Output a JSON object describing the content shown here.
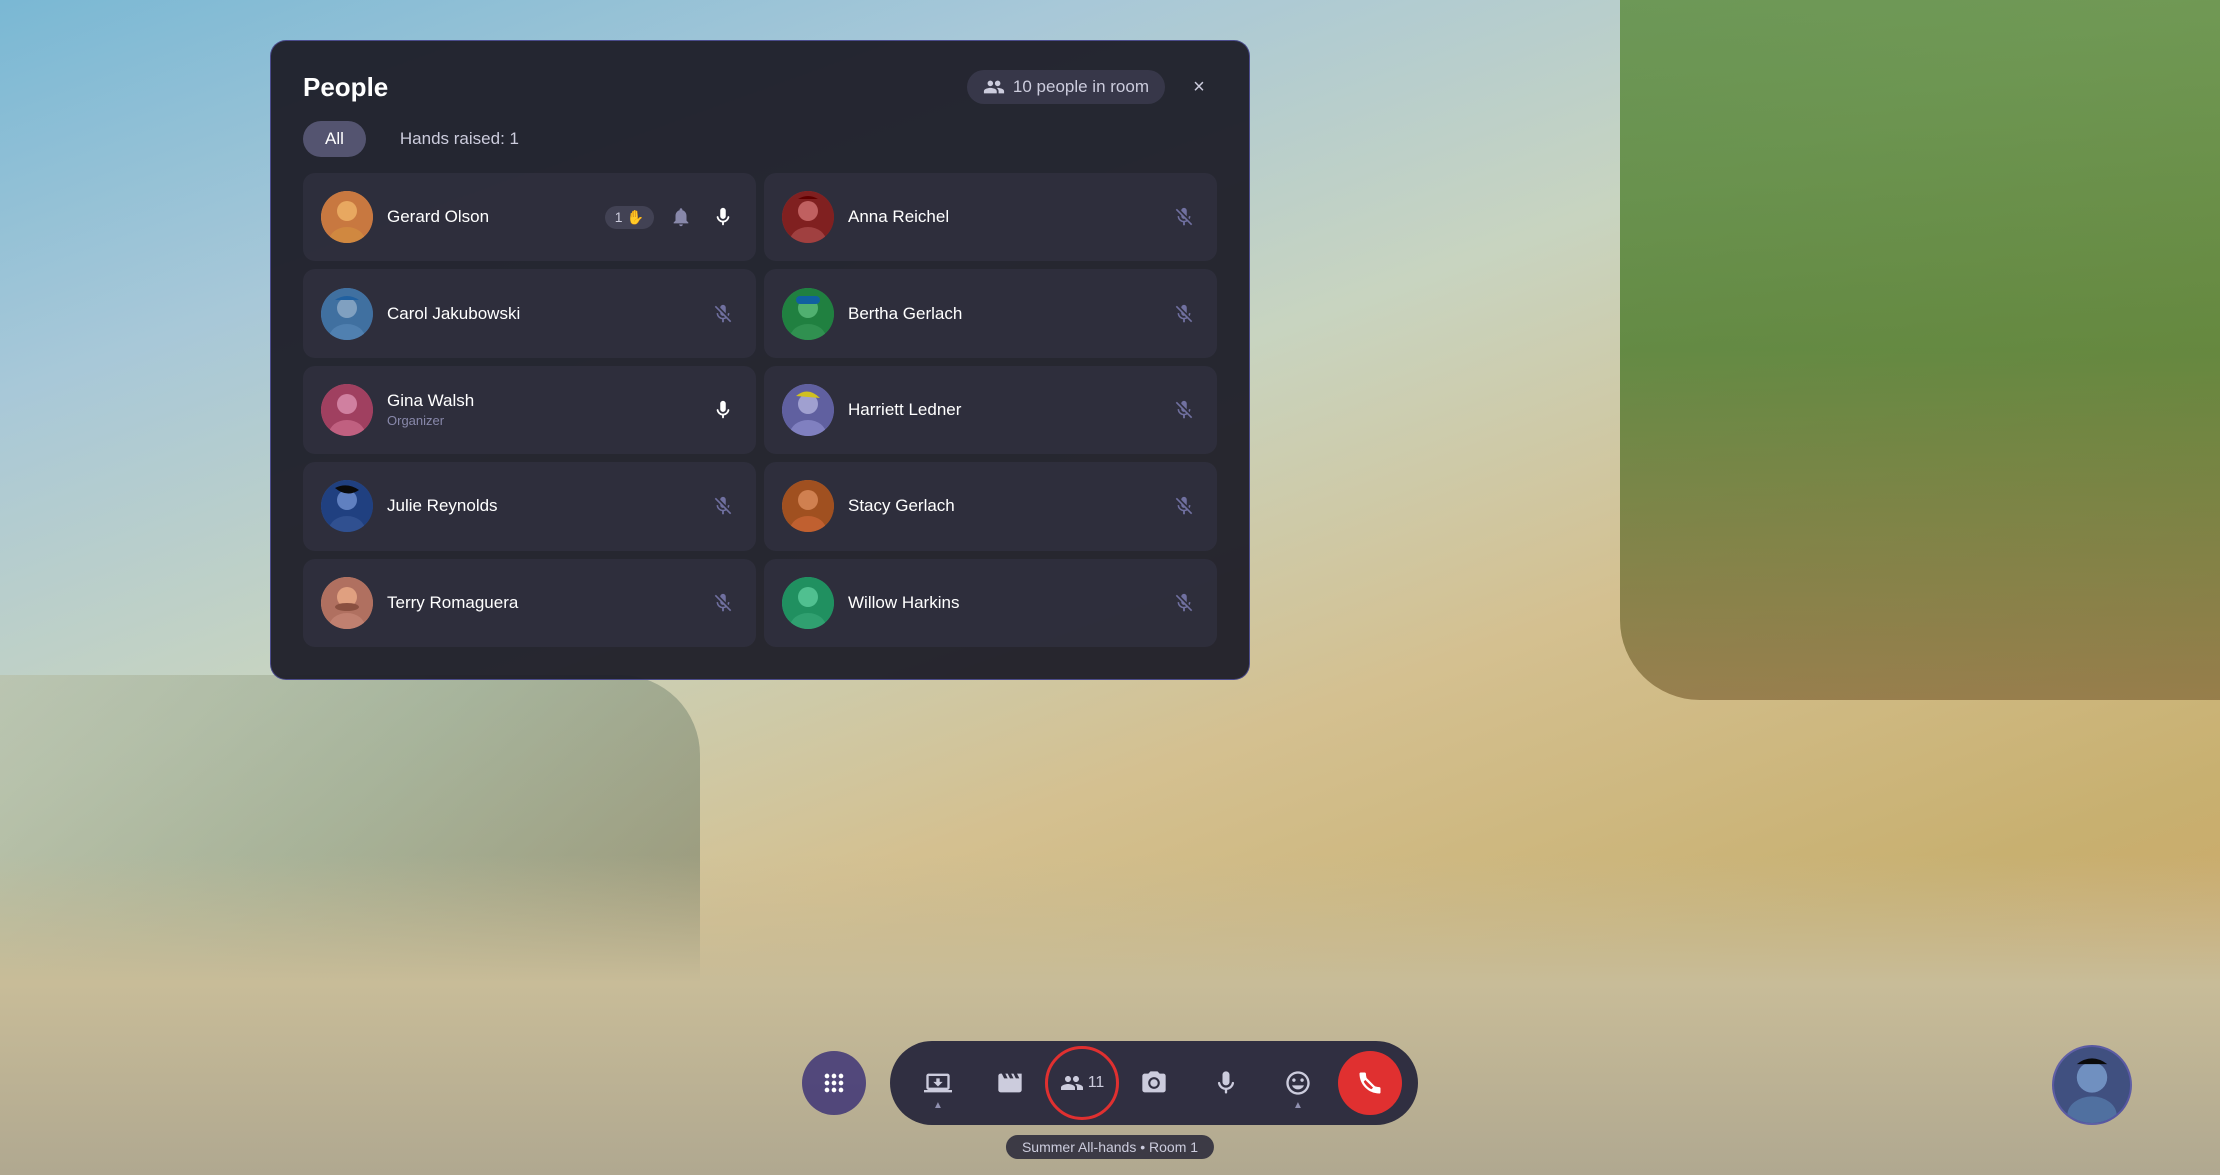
{
  "background": {
    "description": "Virtual meeting room with couch, tree, outdoor scene"
  },
  "panel": {
    "title": "People",
    "people_count": "10 people in room",
    "close_label": "×",
    "tabs": [
      {
        "id": "all",
        "label": "All",
        "active": true
      },
      {
        "id": "hands",
        "label": "Hands raised: 1",
        "active": false
      }
    ],
    "participants": [
      {
        "id": "gerard",
        "name": "Gerard Olson",
        "role": "",
        "hand_raised": true,
        "hand_count": "1",
        "muted": false,
        "has_bell": true,
        "avatar_class": "av-gerard",
        "avatar_emoji": "🧑"
      },
      {
        "id": "anna",
        "name": "Anna Reichel",
        "role": "",
        "hand_raised": false,
        "muted": true,
        "avatar_class": "av-anna",
        "avatar_emoji": "👩"
      },
      {
        "id": "carol",
        "name": "Carol Jakubowski",
        "role": "",
        "hand_raised": false,
        "muted": true,
        "avatar_class": "av-carol",
        "avatar_emoji": "👩"
      },
      {
        "id": "bertha",
        "name": "Bertha Gerlach",
        "role": "",
        "hand_raised": false,
        "muted": true,
        "avatar_class": "av-bertha",
        "avatar_emoji": "👩"
      },
      {
        "id": "gina",
        "name": "Gina Walsh",
        "role": "Organizer",
        "hand_raised": false,
        "muted": false,
        "avatar_class": "av-gina",
        "avatar_emoji": "👩"
      },
      {
        "id": "harriett",
        "name": "Harriett Ledner",
        "role": "",
        "hand_raised": false,
        "muted": true,
        "avatar_class": "av-harriett",
        "avatar_emoji": "👩"
      },
      {
        "id": "julie",
        "name": "Julie Reynolds",
        "role": "",
        "hand_raised": false,
        "muted": true,
        "avatar_class": "av-julie",
        "avatar_emoji": "👩"
      },
      {
        "id": "stacy",
        "name": "Stacy Gerlach",
        "role": "",
        "hand_raised": false,
        "muted": true,
        "avatar_class": "av-stacy",
        "avatar_emoji": "👩"
      },
      {
        "id": "terry",
        "name": "Terry Romaguera",
        "role": "",
        "hand_raised": false,
        "muted": true,
        "avatar_class": "av-terry",
        "avatar_emoji": "🧔"
      },
      {
        "id": "willow",
        "name": "Willow Harkins",
        "role": "",
        "hand_raised": false,
        "muted": true,
        "avatar_class": "av-willow",
        "avatar_emoji": "👩"
      }
    ]
  },
  "toolbar": {
    "dots_label": "⋮⋮⋮",
    "share_label": "share",
    "content_label": "content",
    "people_label": "people",
    "people_count": "11",
    "camera_label": "camera",
    "mic_label": "mic",
    "emoji_label": "emoji",
    "end_label": "end",
    "meeting_label": "Summer All-hands • Room 1"
  }
}
